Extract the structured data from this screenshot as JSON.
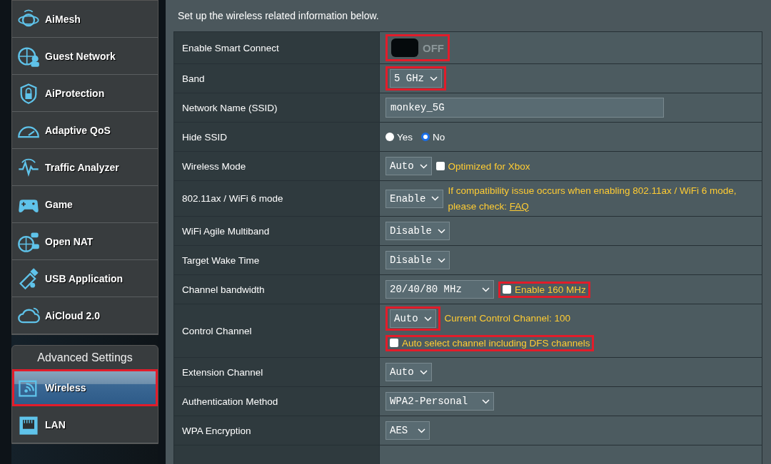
{
  "sidebar": {
    "items": [
      {
        "label": "AiMesh",
        "selected": false
      },
      {
        "label": "Guest Network",
        "selected": false
      },
      {
        "label": "AiProtection",
        "selected": false
      },
      {
        "label": "Adaptive QoS",
        "selected": false
      },
      {
        "label": "Traffic Analyzer",
        "selected": false
      },
      {
        "label": "Game",
        "selected": false
      },
      {
        "label": "Open NAT",
        "selected": false
      },
      {
        "label": "USB Application",
        "selected": false
      },
      {
        "label": "AiCloud 2.0",
        "selected": false
      }
    ]
  },
  "advanced": {
    "title": "Advanced Settings",
    "items": [
      {
        "label": "Wireless",
        "selected": true,
        "highlighted": true
      },
      {
        "label": "LAN",
        "selected": false,
        "highlighted": false
      }
    ]
  },
  "intro": "Set up the wireless related information below.",
  "rows": [
    {
      "label": "Enable Smart Connect",
      "lines": [
        [
          {
            "kind": "toggle",
            "text": "OFF",
            "on": false,
            "highlighted": true
          }
        ]
      ]
    },
    {
      "label": "Band",
      "lines": [
        [
          {
            "kind": "select",
            "value": "5 GHz",
            "highlighted": true
          }
        ]
      ]
    },
    {
      "label": "Network Name (SSID)",
      "lines": [
        [
          {
            "kind": "input",
            "value": "monkey_5G",
            "highlighted": false
          }
        ]
      ]
    },
    {
      "label": "Hide SSID",
      "lines": [
        [
          {
            "kind": "radio",
            "options": [
              {
                "label": "Yes",
                "selected": false
              },
              {
                "label": "No",
                "selected": true
              }
            ],
            "highlighted": false
          }
        ]
      ]
    },
    {
      "label": "Wireless Mode",
      "lines": [
        [
          {
            "kind": "select",
            "value": "Auto",
            "highlighted": false
          },
          {
            "kind": "checkbox",
            "label": "Optimized for Xbox",
            "checked": false,
            "highlighted": false
          }
        ]
      ]
    },
    {
      "label": "802.11ax / WiFi 6 mode",
      "lines": [
        [
          {
            "kind": "select",
            "value": "Enable",
            "highlighted": false
          },
          {
            "kind": "note",
            "text": "If compatibility issue occurs when enabling 802.11ax / WiFi 6 mode, please check: ",
            "link": "FAQ",
            "highlighted": false
          }
        ]
      ]
    },
    {
      "label": "WiFi Agile Multiband",
      "lines": [
        [
          {
            "kind": "select",
            "value": "Disable",
            "highlighted": false
          }
        ]
      ]
    },
    {
      "label": "Target Wake Time",
      "lines": [
        [
          {
            "kind": "select",
            "value": "Disable",
            "highlighted": false
          }
        ]
      ]
    },
    {
      "label": "Channel bandwidth",
      "lines": [
        [
          {
            "kind": "select",
            "value": "20/40/80 MHz",
            "highlighted": false
          },
          {
            "kind": "checkbox",
            "label": "Enable 160 MHz",
            "checked": false,
            "highlighted": true
          }
        ]
      ]
    },
    {
      "label": "Control Channel",
      "lines": [
        [
          {
            "kind": "select",
            "value": "Auto",
            "highlighted": true
          },
          {
            "kind": "note",
            "text": "Current Control Channel: 100",
            "highlighted": false
          }
        ],
        [
          {
            "kind": "checkbox",
            "label": "Auto select channel including DFS channels",
            "checked": false,
            "highlighted": true
          }
        ]
      ]
    },
    {
      "label": "Extension Channel",
      "lines": [
        [
          {
            "kind": "select",
            "value": "Auto",
            "highlighted": false
          }
        ]
      ]
    },
    {
      "label": "Authentication Method",
      "lines": [
        [
          {
            "kind": "select",
            "value": "WPA2-Personal",
            "highlighted": false
          }
        ]
      ]
    },
    {
      "label": "WPA Encryption",
      "lines": [
        [
          {
            "kind": "select",
            "value": "AES",
            "highlighted": false
          }
        ]
      ]
    }
  ]
}
